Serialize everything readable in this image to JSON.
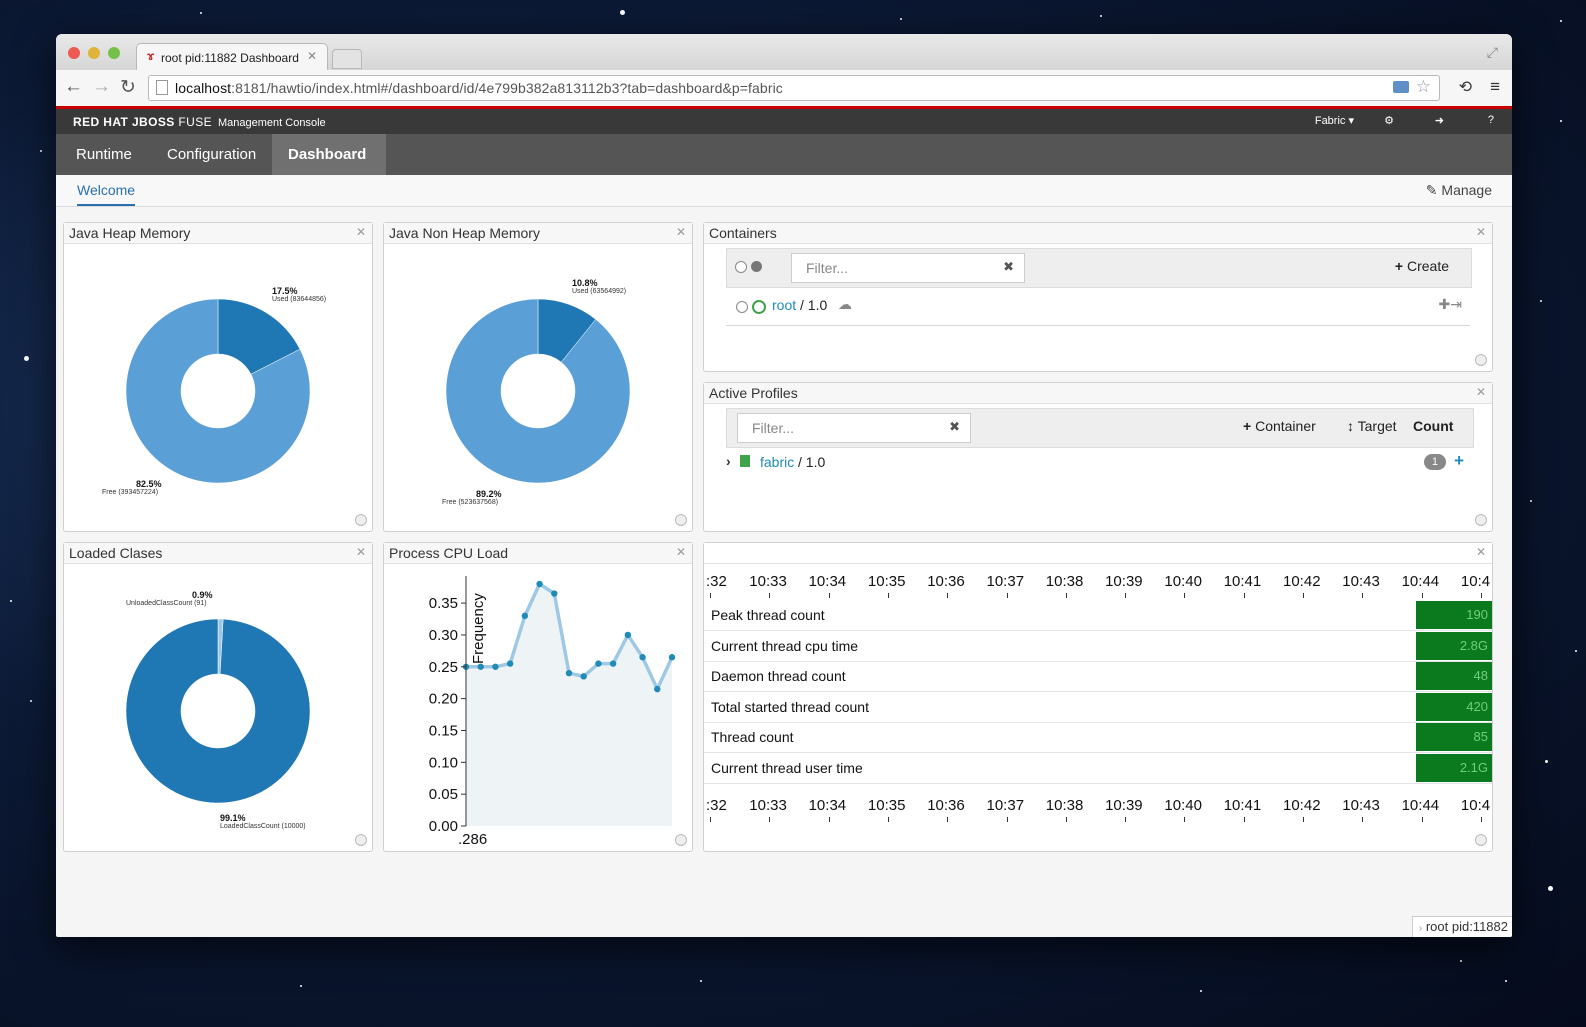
{
  "browser": {
    "tab_title": "root pid:11882 Dashboard",
    "url_host": "localhost",
    "url_rest": ":8181/hawtio/index.html#/dashboard/id/4e799b382a813112b3?tab=dashboard&p=fabric"
  },
  "app": {
    "brand": "RED HAT JBOSS",
    "product": "FUSE",
    "subtitle": "Management Console",
    "fabric_menu": "Fabric",
    "nav": [
      "Runtime",
      "Configuration",
      "Dashboard"
    ],
    "subnav_welcome": "Welcome",
    "manage": "Manage",
    "status": "root  pid:11882"
  },
  "widgets": {
    "heap": {
      "title": "Java Heap Memory",
      "used_pct": "17.5%",
      "used_label": "Used (83644856)",
      "free_pct": "82.5%",
      "free_label": "Free (393457224)"
    },
    "nonheap": {
      "title": "Java Non Heap Memory",
      "used_pct": "10.8%",
      "used_label": "Used (63564992)",
      "free_pct": "89.2%",
      "free_label": "Free (523637568)"
    },
    "containers": {
      "title": "Containers",
      "filter_placeholder": "Filter...",
      "create": "Create",
      "row_name": "root",
      "row_version": "/ 1.0"
    },
    "profiles": {
      "title": "Active Profiles",
      "filter_placeholder": "Filter...",
      "container_btn": "Container",
      "target_btn": "Target",
      "count_btn": "Count",
      "row_name": "fabric",
      "row_version": "/ 1.0",
      "row_count": "1"
    },
    "classes": {
      "title": "Loaded Clases",
      "unloaded_pct": "0.9%",
      "unloaded_label": "UnloadedClassCount (91)",
      "loaded_pct": "99.1%",
      "loaded_label": "LoadedClassCount (10000)"
    },
    "cpu": {
      "title": "Process CPU Load",
      "ylabel": "Frequency",
      "xlabel": ".286"
    },
    "threads": {
      "times": [
        ":32",
        "10:33",
        "10:34",
        "10:35",
        "10:36",
        "10:37",
        "10:38",
        "10:39",
        "10:40",
        "10:41",
        "10:42",
        "10:43",
        "10:44",
        "10:4"
      ],
      "rows": [
        {
          "name": "Peak thread count",
          "value": "190"
        },
        {
          "name": "Current thread cpu time",
          "value": "2.8G"
        },
        {
          "name": "Daemon thread count",
          "value": "48"
        },
        {
          "name": "Total started thread count",
          "value": "420"
        },
        {
          "name": "Thread count",
          "value": "85"
        },
        {
          "name": "Current thread user time",
          "value": "2.1G"
        }
      ]
    }
  },
  "chart_data": [
    {
      "type": "pie",
      "title": "Java Heap Memory",
      "labels": [
        "Used",
        "Free"
      ],
      "values": [
        17.5,
        82.5
      ],
      "colors": [
        "#1f77b4",
        "#5aa0d6"
      ]
    },
    {
      "type": "pie",
      "title": "Java Non Heap Memory",
      "labels": [
        "Used",
        "Free"
      ],
      "values": [
        10.8,
        89.2
      ],
      "colors": [
        "#1f77b4",
        "#5aa0d6"
      ]
    },
    {
      "type": "pie",
      "title": "Loaded Clases",
      "labels": [
        "UnloadedClassCount",
        "LoadedClassCount"
      ],
      "values": [
        0.9,
        99.1
      ],
      "colors": [
        "#9cc6e8",
        "#1f77b4"
      ]
    },
    {
      "type": "line",
      "title": "Process CPU Load",
      "ylabel": "Frequency",
      "yticks": [
        "0.00",
        "0.05",
        "0.10",
        "0.15",
        "0.20",
        "0.25",
        "0.30",
        "0.35"
      ],
      "ylim": [
        0,
        0.38
      ],
      "values": [
        0.25,
        0.25,
        0.25,
        0.255,
        0.33,
        0.38,
        0.365,
        0.24,
        0.235,
        0.255,
        0.255,
        0.3,
        0.265,
        0.215,
        0.265
      ]
    }
  ]
}
